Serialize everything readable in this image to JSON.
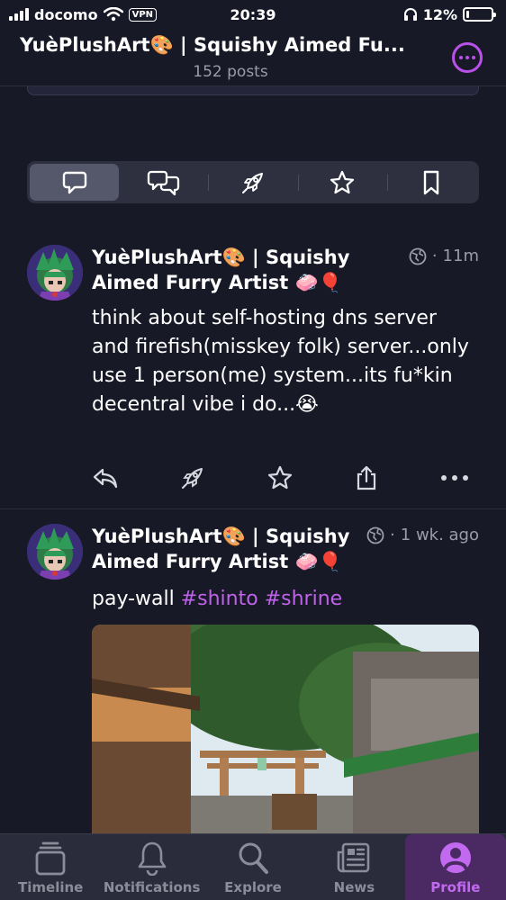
{
  "status_bar": {
    "carrier": "docomo",
    "vpn_label": "VPN",
    "time": "20:39",
    "battery_text": "12%",
    "battery_level": 0.12
  },
  "header": {
    "title": "YuèPlushArt🎨 | Squishy Aimed Fu...",
    "subtitle": "152 posts",
    "accent": "#b950e8"
  },
  "tabs": [
    {
      "icon": "chat-bubble-icon",
      "active": true
    },
    {
      "icon": "chat-bubbles-icon",
      "active": false
    },
    {
      "icon": "rocket-icon",
      "active": false
    },
    {
      "icon": "star-icon",
      "active": false
    },
    {
      "icon": "bookmark-icon",
      "active": false
    }
  ],
  "posts": [
    {
      "author": "YuèPlushArt🎨 | Squishy Aimed Furry Artist 🧼🎈",
      "time": "11m",
      "visibility_icon": "globe-icon",
      "text": "think about self-hosting dns server and firefish(misskey folk) server...only use 1 person(me) system...its fu*kin decentral vibe i do...😭"
    },
    {
      "author": "YuèPlushArt🎨 | Squishy Aimed Furry Artist 🧼🎈",
      "time": "1 wk. ago",
      "visibility_icon": "globe-icon",
      "text_prefix": "pay-wall ",
      "hashtags": [
        "#shinto",
        "#shrine"
      ]
    }
  ],
  "bottom_nav": [
    {
      "label": "Timeline",
      "icon": "timeline-icon",
      "active": false
    },
    {
      "label": "Notifications",
      "icon": "bell-icon",
      "active": false
    },
    {
      "label": "Explore",
      "icon": "search-icon",
      "active": false
    },
    {
      "label": "News",
      "icon": "newspaper-icon",
      "active": false
    },
    {
      "label": "Profile",
      "icon": "profile-icon",
      "active": true
    }
  ],
  "colors": {
    "background": "#181927",
    "accent": "#c062ec",
    "muted": "#9a9caa"
  }
}
